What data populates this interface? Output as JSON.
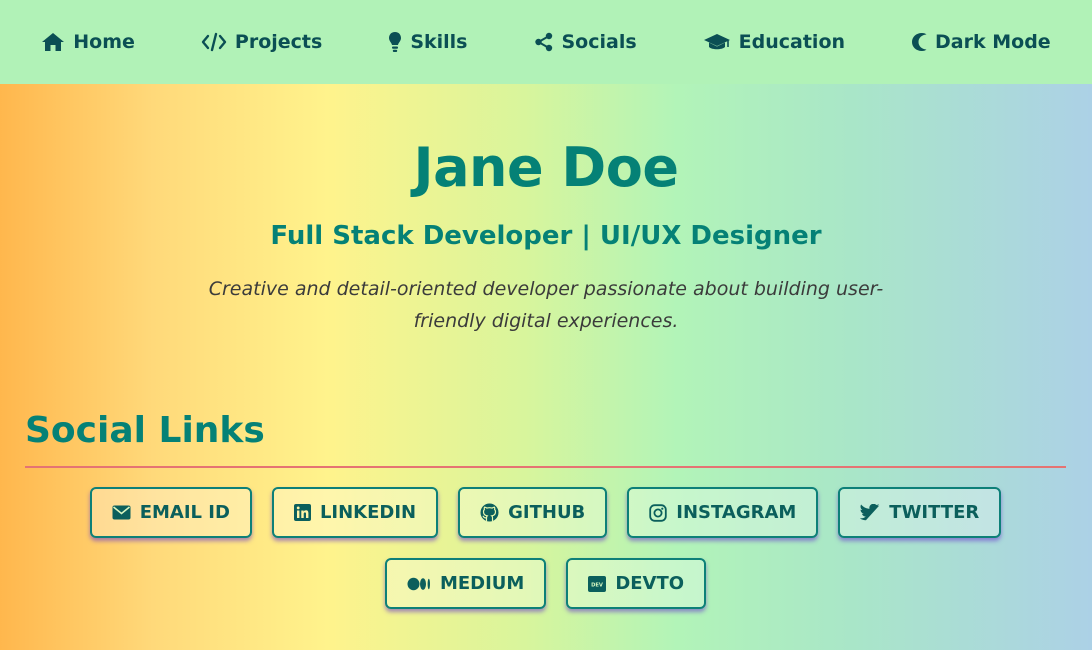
{
  "nav": {
    "items": [
      {
        "label": "Home",
        "icon": "home-icon"
      },
      {
        "label": "Projects",
        "icon": "code-icon"
      },
      {
        "label": "Skills",
        "icon": "lightbulb-icon"
      },
      {
        "label": "Socials",
        "icon": "share-icon"
      },
      {
        "label": "Education",
        "icon": "graduation-cap-icon"
      },
      {
        "label": "Dark Mode",
        "icon": "moon-icon"
      }
    ]
  },
  "hero": {
    "name": "Jane Doe",
    "title": "Full Stack Developer | UI/UX Designer",
    "description": "Creative and detail-oriented developer passionate about building user-friendly digital experiences."
  },
  "socials": {
    "heading": "Social Links",
    "links": [
      {
        "label": "EMAIL ID",
        "icon": "envelope-icon"
      },
      {
        "label": "LINKEDIN",
        "icon": "linkedin-icon"
      },
      {
        "label": "GITHUB",
        "icon": "github-icon"
      },
      {
        "label": "INSTAGRAM",
        "icon": "instagram-icon"
      },
      {
        "label": "TWITTER",
        "icon": "twitter-icon"
      },
      {
        "label": "MEDIUM",
        "icon": "medium-icon"
      },
      {
        "label": "DEVTO",
        "icon": "devto-icon"
      }
    ]
  },
  "colors": {
    "accent": "#058176",
    "nav_background": "#b1f2b7",
    "divider": "#e57373",
    "button_shadow": "#6633cc"
  }
}
